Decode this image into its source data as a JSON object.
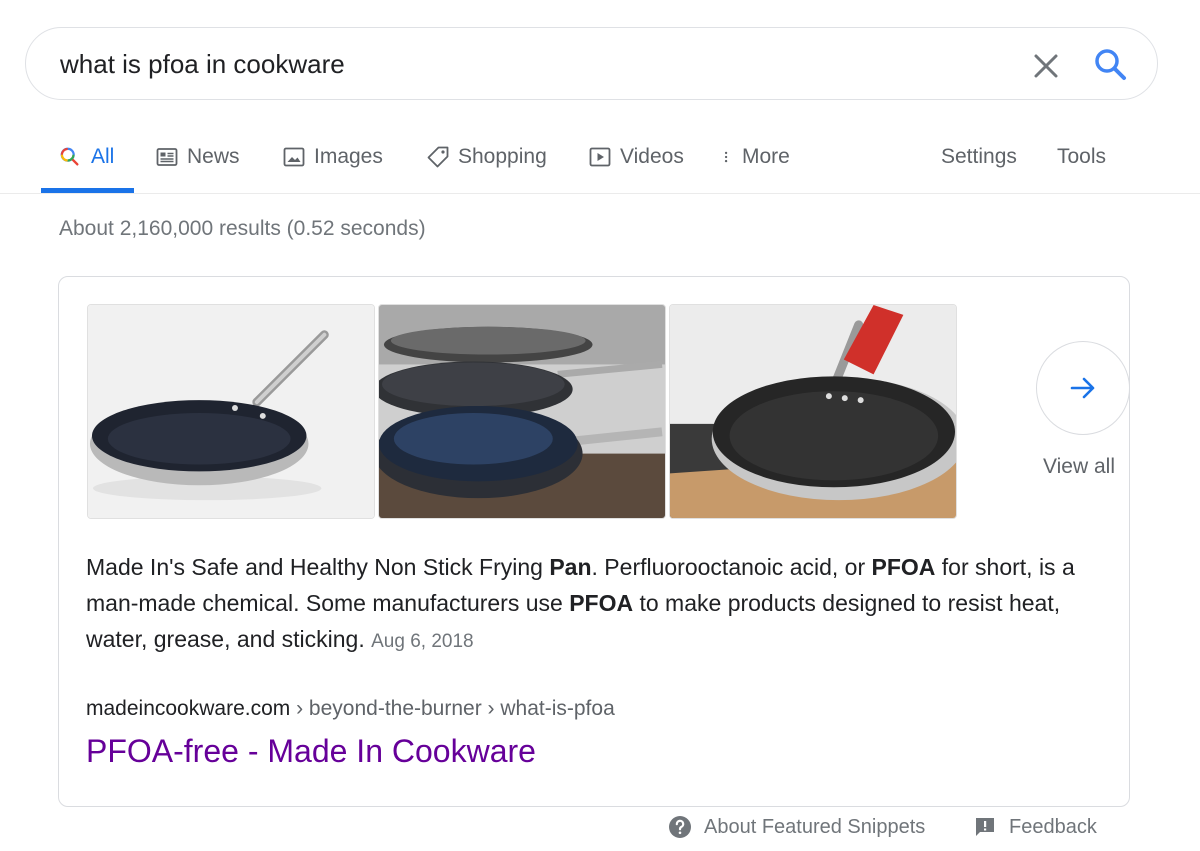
{
  "search": {
    "query": "what is pfoa in cookware"
  },
  "tabs": [
    {
      "label": "All"
    },
    {
      "label": "News"
    },
    {
      "label": "Images"
    },
    {
      "label": "Shopping"
    },
    {
      "label": "Videos"
    },
    {
      "label": "More"
    },
    {
      "label": "Settings"
    },
    {
      "label": "Tools"
    }
  ],
  "result_stats": "About 2,160,000 results (0.52 seconds)",
  "snippet": {
    "view_all": "View all",
    "text": {
      "p1": "Made In's Safe and Healthy Non Stick Frying ",
      "b1": "Pan",
      "p2": ". Perfluorooctanoic acid, or ",
      "b2": "PFOA",
      "p3": " for short, is a man-made chemical. Some manufacturers use ",
      "b3": "PFOA",
      "p4": " to make products designed to resist heat, water, grease, and sticking. ",
      "date": "Aug 6, 2018"
    },
    "cite_domain": "madeincookware.com",
    "cite_path": " › beyond-the-burner › what-is-pfoa",
    "link_title": "PFOA-free - Made In Cookware"
  },
  "footer": {
    "about": "About Featured Snippets",
    "feedback": "Feedback"
  },
  "colors": {
    "accent": "#1a73e8",
    "visited_link": "#660099",
    "muted": "#70757a"
  }
}
